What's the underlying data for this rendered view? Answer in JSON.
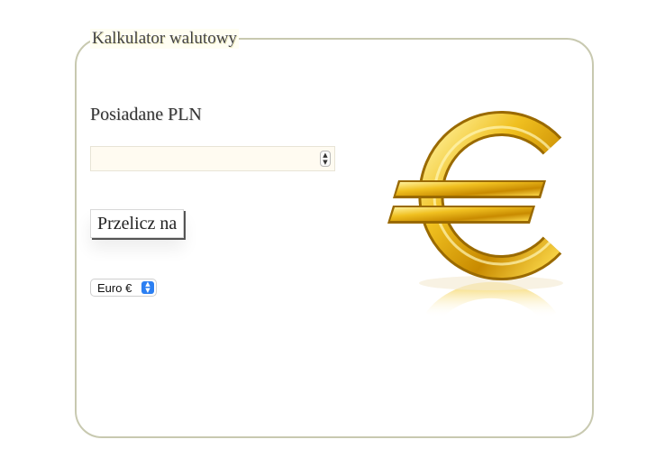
{
  "form": {
    "legend": "Kalkulator walutowy",
    "amount_label": "Posiadane PLN",
    "amount_value": "",
    "convert_button": "Przelicz na",
    "currency_selected": "Euro €"
  },
  "image": {
    "icon": "euro-sign-icon",
    "colors": {
      "gold": "#e9b20b",
      "gold_light": "#ffe46a",
      "gold_dark": "#9a6a00"
    }
  }
}
